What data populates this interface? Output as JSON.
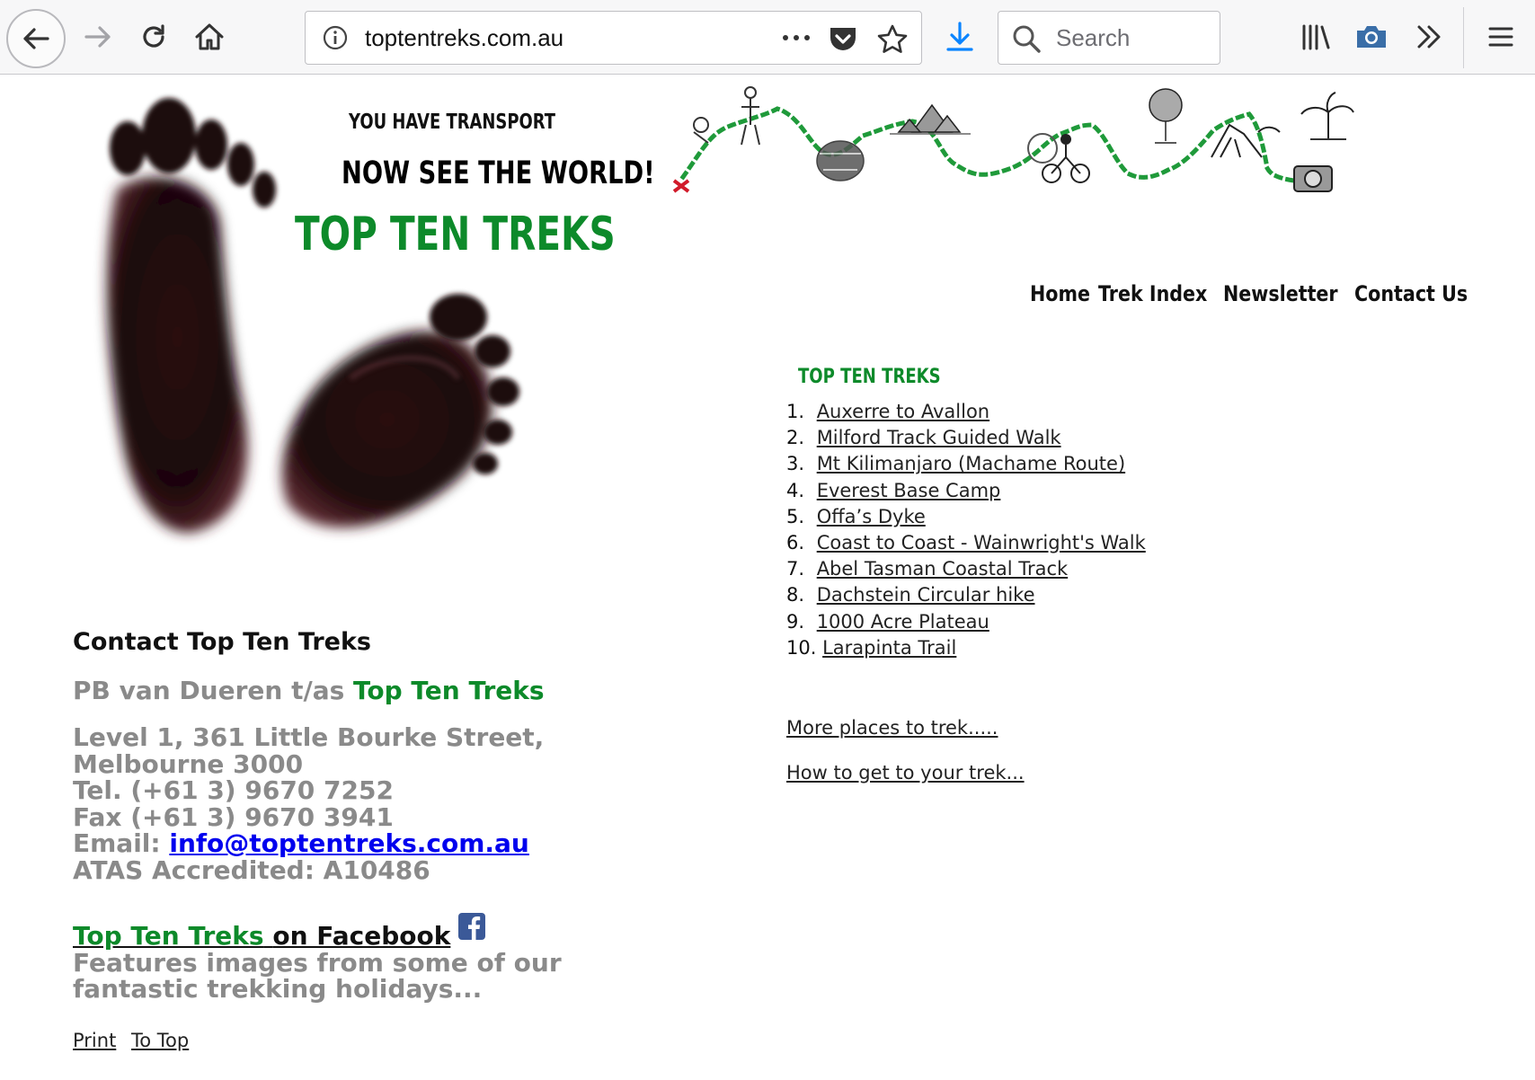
{
  "browser": {
    "url": "toptentreks.com.au",
    "search_placeholder": "Search"
  },
  "banner": {
    "line1": "YOU HAVE TRANSPORT",
    "line2": "NOW SEE THE WORLD!",
    "brand": "TOP TEN TREKS"
  },
  "nav": {
    "items": [
      "Home",
      "Trek Index",
      "Newsletter",
      "Contact Us"
    ]
  },
  "section": {
    "heading": "TOP TEN TREKS"
  },
  "treks": [
    {
      "num": "1.",
      "label": "Auxerre to Avallon"
    },
    {
      "num": "2.",
      "label": "Milford Track Guided Walk"
    },
    {
      "num": "3.",
      "label": "Mt Kilimanjaro (Machame Route)"
    },
    {
      "num": "4.",
      "label": "Everest Base Camp"
    },
    {
      "num": "5.",
      "label": "Offa’s Dyke"
    },
    {
      "num": "6.",
      "label": "Coast to Coast - Wainwright's Walk"
    },
    {
      "num": "7.",
      "label": "Abel Tasman Coastal Track"
    },
    {
      "num": "8.",
      "label": "Dachstein Circular hike"
    },
    {
      "num": "9.",
      "label": "1000 Acre Plateau"
    },
    {
      "num": "10.",
      "label": "Larapinta Trail"
    }
  ],
  "links": {
    "more": "More places to trek.....",
    "howto": "How to get to your trek..."
  },
  "contact": {
    "heading": "Contact Top Ten Treks",
    "name_prefix": "PB van Dueren t/as",
    "name_brand": "Top Ten Treks",
    "address1": "Level 1, 361 Little Bourke Street,",
    "address2": "Melbourne 3000",
    "tel": "Tel. (+61 3) 9670 7252",
    "fax": "Fax (+61 3) 9670 3941",
    "email_label": "Email:",
    "email": "info@toptentreks.com.au",
    "atas": "ATAS Accredited: A10486",
    "facebook_brand": "Top Ten Treks",
    "facebook_suffix": "on Facebook",
    "facebook_desc1": "Features images from some of our",
    "facebook_desc2": "fantastic trekking holidays..."
  },
  "footer": {
    "print": "Print",
    "top": "To Top"
  },
  "colors": {
    "brand_green": "#0d8a2a",
    "grey_text": "#8a8a8a",
    "link_blue": "#0000ee",
    "download_blue": "#0a84ff"
  }
}
